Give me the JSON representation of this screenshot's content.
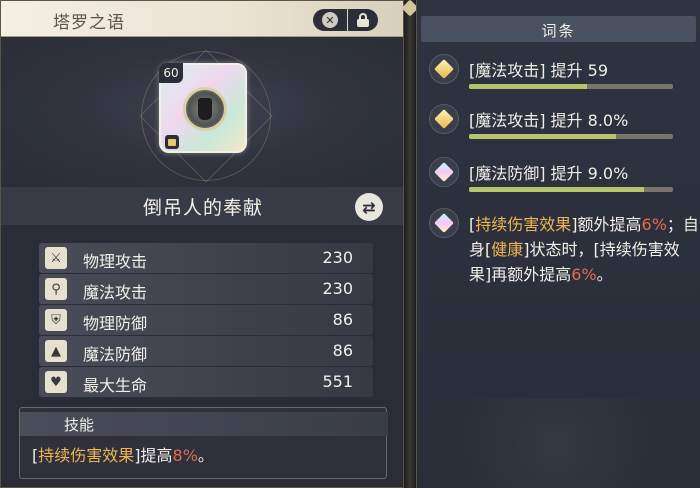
{
  "left_panel": {
    "title": "塔罗之语",
    "card_level": "60",
    "card_name": "倒吊人的奉献",
    "stats": [
      {
        "icon": "sword-icon",
        "glyph": "⚔",
        "label": "物理攻击",
        "value": "230"
      },
      {
        "icon": "wand-icon",
        "glyph": "⚲",
        "label": "魔法攻击",
        "value": "230"
      },
      {
        "icon": "shield-icon",
        "glyph": "⛨",
        "label": "物理防御",
        "value": "86"
      },
      {
        "icon": "wizard-hat-icon",
        "glyph": "▲",
        "label": "魔法防御",
        "value": "86"
      },
      {
        "icon": "heart-icon",
        "glyph": "♥",
        "label": "最大生命",
        "value": "551"
      }
    ],
    "skill": {
      "title": "技能",
      "open_bracket": "[",
      "effect": "持续伤害效果",
      "close_bracket": "]",
      "mid": "提高",
      "percent": "8%",
      "end": "。"
    }
  },
  "right_panel": {
    "title": "词条",
    "entries": [
      {
        "gem": "gold",
        "text": "[魔法攻击] 提升 59",
        "bar_fill": 0.58
      },
      {
        "gem": "gold",
        "text": "[魔法攻击] 提升 8.0%",
        "bar_fill": 0.72
      },
      {
        "gem": "prism",
        "text": "[魔法防御] 提升 9.0%",
        "bar_fill": 0.86
      }
    ],
    "special_entry": {
      "gem": "prism",
      "p1": "[",
      "effect1": "持续伤害效果",
      "p2": "]额外提高",
      "pct1": "6%",
      "p3": "；自身[",
      "effect2": "健康",
      "p4": "]状态时，[持续伤害效果]再额外提高",
      "pct2": "6%",
      "p5": "。"
    }
  },
  "colors": {
    "accent_orange": "#f0b552",
    "accent_red": "#e56a50",
    "bar_fill": "#b6c46e"
  }
}
